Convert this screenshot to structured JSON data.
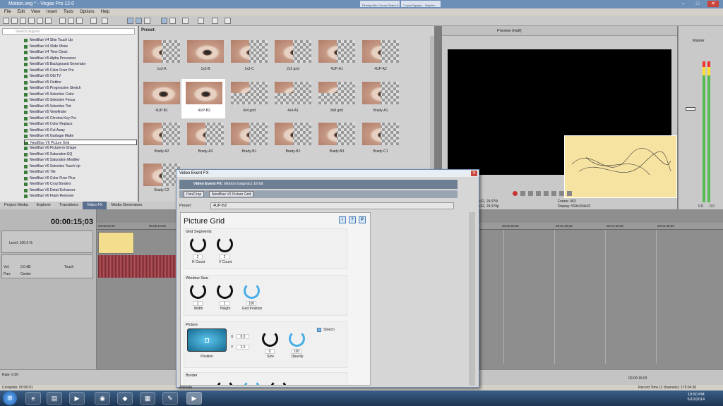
{
  "window": {
    "title": "Motion.veg * - Vegas Pro 12.0",
    "browser_tabs": [
      "Pinning Mix: Corner Shape A...",
      "7 open Nguyen - Graphic...",
      ""
    ]
  },
  "menu": [
    "File",
    "Edit",
    "View",
    "Insert",
    "Tools",
    "Options",
    "Help"
  ],
  "plugin_search_placeholder": "Search plug-ins",
  "plugins": [
    "NewBlue V4 Skin Touch Up",
    "NewBlue V4 Slide Show",
    "NewBlue V4 Time Clock",
    "NewBlue V5 Alpha Processor",
    "NewBlue V5 Background Generator",
    "NewBlue V5 Color Fixer Pro",
    "NewBlue V5 Old TV",
    "NewBlue V5 Outline",
    "NewBlue V5 Progressive Stretch",
    "NewBlue V5 Selective Color",
    "NewBlue V5 Selective Focus",
    "NewBlue V5 Selective Tint",
    "NewBlue V5 Viewfinder",
    "NewBlue V6 Chroma Key Pro",
    "NewBlue V6 Color Replace",
    "NewBlue V6 Cut Away",
    "NewBlue V6 Garbage Matte",
    "NewBlue V6 Picture Grid",
    "NewBlue V6 Picture-in-Shape",
    "NewBlue V6 Saturation EQ",
    "NewBlue V6 Saturation Modifier",
    "NewBlue V6 Selective Touch Up",
    "NewBlue V6 Tile",
    "NewBlue V6 Color Fixer Plus",
    "NewBlue V6 Crop Borders",
    "NewBlue V6 Detail Enhancer",
    "NewBlue V6 Flash Remover",
    "NewBlue V6 Picture Grid"
  ],
  "presets_label": "Preset:",
  "presets": [
    "1x3-A",
    "1x3-B",
    "1x3-C",
    "2x2 grid",
    "4UP-A1",
    "4UP-A2",
    "4UP-B1",
    "4UP-B2",
    "4x4 grid",
    "4x4-A1",
    "8x8 grid",
    "Brady-A1",
    "Brady-A2",
    "Brady-A3",
    "Brady-B1",
    "Brady-B2",
    "Brady-B3",
    "Brady-C1",
    "Brady-C2"
  ],
  "bottom_tabs": [
    "Project Media",
    "Explorer",
    "Transitions",
    "Video FX",
    "Media Generators"
  ],
  "preview": {
    "mode": "Preview (Half)",
    "frame_label": "Frame:",
    "frame": "453",
    "display_label": "Display:",
    "display": "593x334x32",
    "left_line1": "x32, 29.970i",
    "left_line2": "x32, 29.970p"
  },
  "master": {
    "label": "Master",
    "readout_l": "0.0",
    "readout_r": "0.0",
    "db_labels": [
      "-Inf.",
      "-Inf.",
      "3",
      "6",
      "9",
      "12",
      "15",
      "18",
      "21",
      "24",
      "27",
      "30",
      "33",
      "36",
      "39",
      "42",
      "45",
      "48",
      "51",
      "54",
      "57"
    ]
  },
  "timeline": {
    "timecode": "00:00:15;03",
    "ruler": [
      "00:00:00;00",
      "00:00:10;00",
      "00:00:20;00",
      "00:01:29;29",
      "00:01:39;29",
      "00:01:49;29"
    ],
    "level": "Level: 100.0 %",
    "vol": "Vol:",
    "vol_val": "0.0 dB",
    "touch": "Touch",
    "pan": "Pan:",
    "pan_val": "Center",
    "rate": "Rate: 0.00",
    "status_time": "00:00:15;03",
    "complete": "Complete: 00:00:01",
    "record_time": "Record Time (2 channels): 176:04:30"
  },
  "fx": {
    "window_title": "Video Event FX",
    "header": "Video Event FX:",
    "header_sub": "Motion Graphics 16 bit",
    "chain": [
      "Pan/Crop",
      "NewBlue V6 Picture Grid"
    ],
    "preset_label": "Preset:",
    "preset_value": "4UP-B2",
    "panel_title": "Picture Grid",
    "buttons": [
      "i",
      "?",
      "P"
    ],
    "grid_segments": "Grid Segments",
    "h_count_val": "2",
    "h_count": "H Count",
    "v_count_val": "2",
    "v_count": "V Count",
    "window_size": "Window Size",
    "width_val": "1",
    "width": "Width",
    "height_val": "1",
    "height": "Height",
    "grid_pos_val": "100",
    "grid_pos": "Grid Position",
    "picture": "Picture",
    "x_label": "X",
    "x_val": "0.0",
    "y_label": "Y",
    "y_val": "2.0",
    "position": "Position",
    "size_val": "0",
    "size": "Size",
    "opacity_val": "100",
    "opacity": "Opacity",
    "stretch": "Stretch",
    "border": "Border",
    "animate": "Animate"
  },
  "taskbar": {
    "time": "10:50 PM",
    "date": "5/10/2014"
  }
}
